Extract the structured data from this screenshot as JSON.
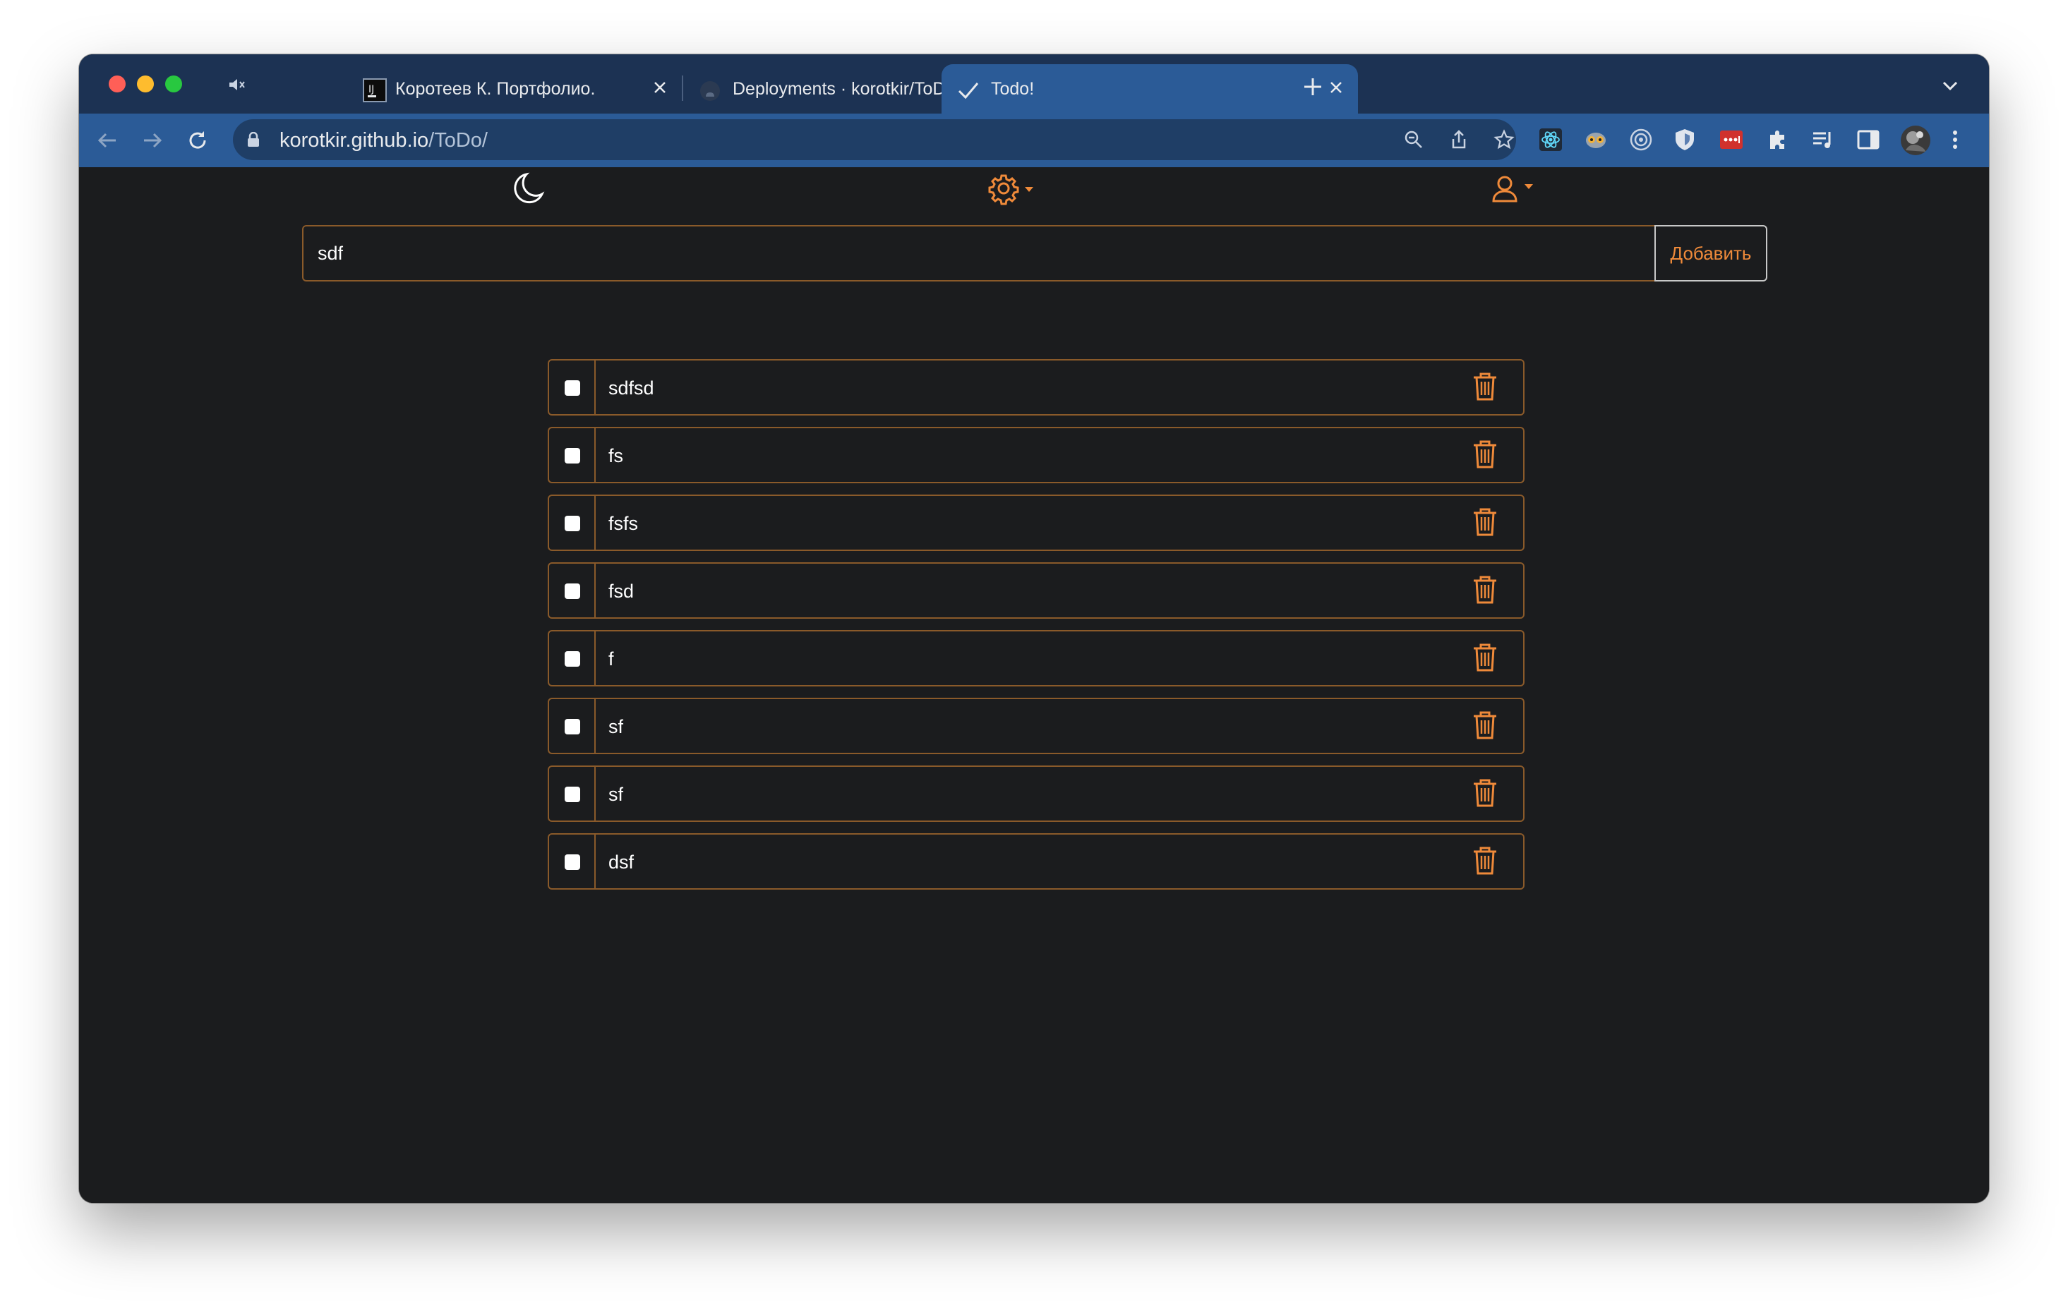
{
  "browser": {
    "tabs": [
      {
        "label": "Коротеев К. Портфолио.",
        "active": false
      },
      {
        "label": "Deployments · korotkir/ToDo",
        "active": false
      },
      {
        "label": "Todo!",
        "active": true
      }
    ],
    "url": {
      "host": "korotkir.github.io",
      "path": "/ToDo/"
    }
  },
  "app": {
    "input_value": "sdf",
    "add_label": "Добавить",
    "todos": [
      {
        "text": "sdfsd",
        "done": false
      },
      {
        "text": "fs",
        "done": false
      },
      {
        "text": "fsfs",
        "done": false
      },
      {
        "text": "fsd",
        "done": false
      },
      {
        "text": "f",
        "done": false
      },
      {
        "text": "sf",
        "done": false
      },
      {
        "text": "sf",
        "done": false
      },
      {
        "text": "dsf",
        "done": false
      }
    ],
    "count": "8",
    "accent_color": "#ef8a3a",
    "background_color": "#1b1c1e"
  }
}
